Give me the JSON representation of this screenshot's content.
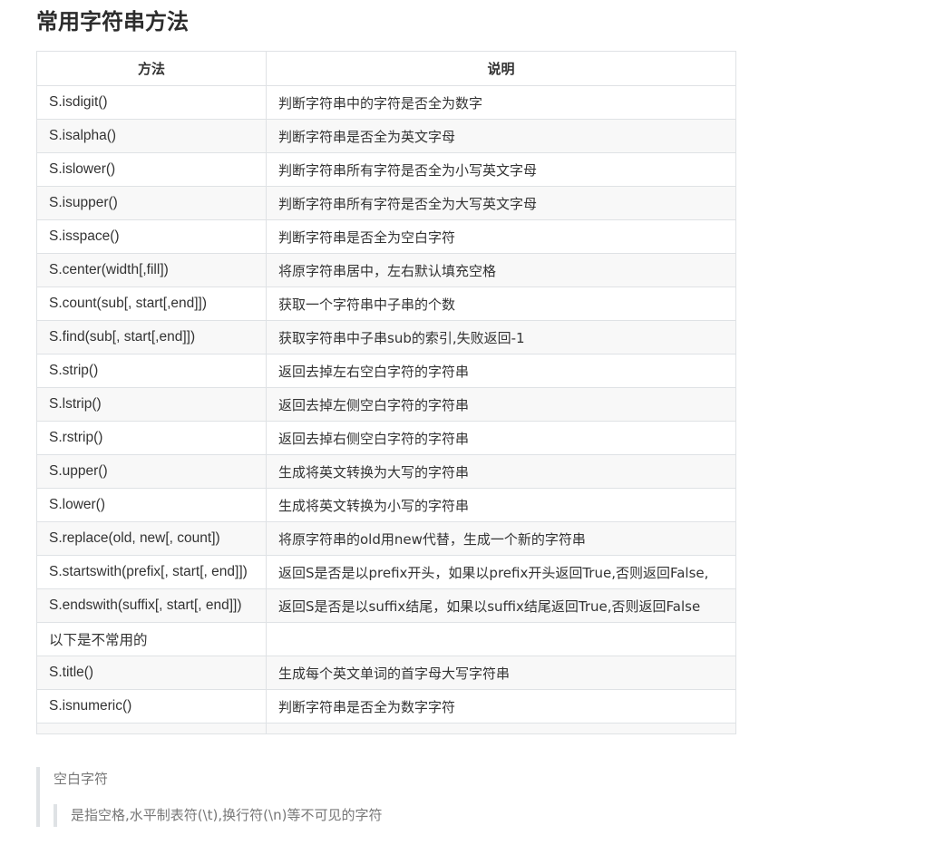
{
  "title": "常用字符串方法",
  "table": {
    "headers": [
      "方法",
      "说明"
    ],
    "rows": [
      {
        "method": "S.isdigit()",
        "desc": "判断字符串中的字符是否全为数字"
      },
      {
        "method": "S.isalpha()",
        "desc": "判断字符串是否全为英文字母"
      },
      {
        "method": "S.islower()",
        "desc": "判断字符串所有字符是否全为小写英文字母"
      },
      {
        "method": "S.isupper()",
        "desc": "判断字符串所有字符是否全为大写英文字母"
      },
      {
        "method": "S.isspace()",
        "desc": "判断字符串是否全为空白字符"
      },
      {
        "method": "S.center(width[,fill])",
        "desc": "将原字符串居中，左右默认填充空格"
      },
      {
        "method": "S.count(sub[, start[,end]])",
        "desc": "获取一个字符串中子串的个数"
      },
      {
        "method": "S.find(sub[, start[,end]])",
        "desc": "获取字符串中子串sub的索引,失败返回-1"
      },
      {
        "method": "S.strip()",
        "desc": "返回去掉左右空白字符的字符串"
      },
      {
        "method": "S.lstrip()",
        "desc": "返回去掉左侧空白字符的字符串"
      },
      {
        "method": "S.rstrip()",
        "desc": "返回去掉右侧空白字符的字符串"
      },
      {
        "method": "S.upper()",
        "desc": "生成将英文转换为大写的字符串"
      },
      {
        "method": "S.lower()",
        "desc": "生成将英文转换为小写的字符串"
      },
      {
        "method": "S.replace(old, new[, count])",
        "desc": "将原字符串的old用new代替，生成一个新的字符串"
      },
      {
        "method": "S.startswith(prefix[, start[, end]])",
        "desc": "返回S是否是以prefix开头，如果以prefix开头返回True,否则返回False,"
      },
      {
        "method": "S.endswith(suffix[, start[, end]])",
        "desc": "返回S是否是以suffix结尾，如果以suffix结尾返回True,否则返回False"
      },
      {
        "method": "以下是不常用的",
        "desc": ""
      },
      {
        "method": "S.title()",
        "desc": "生成每个英文单词的首字母大写字符串"
      },
      {
        "method": "S.isnumeric()",
        "desc": "判断字符串是否全为数字字符"
      }
    ]
  },
  "blockquote": {
    "text": "空白字符",
    "nested": "是指空格,水平制表符(\\t),换行符(\\n)等不可见的字符"
  }
}
